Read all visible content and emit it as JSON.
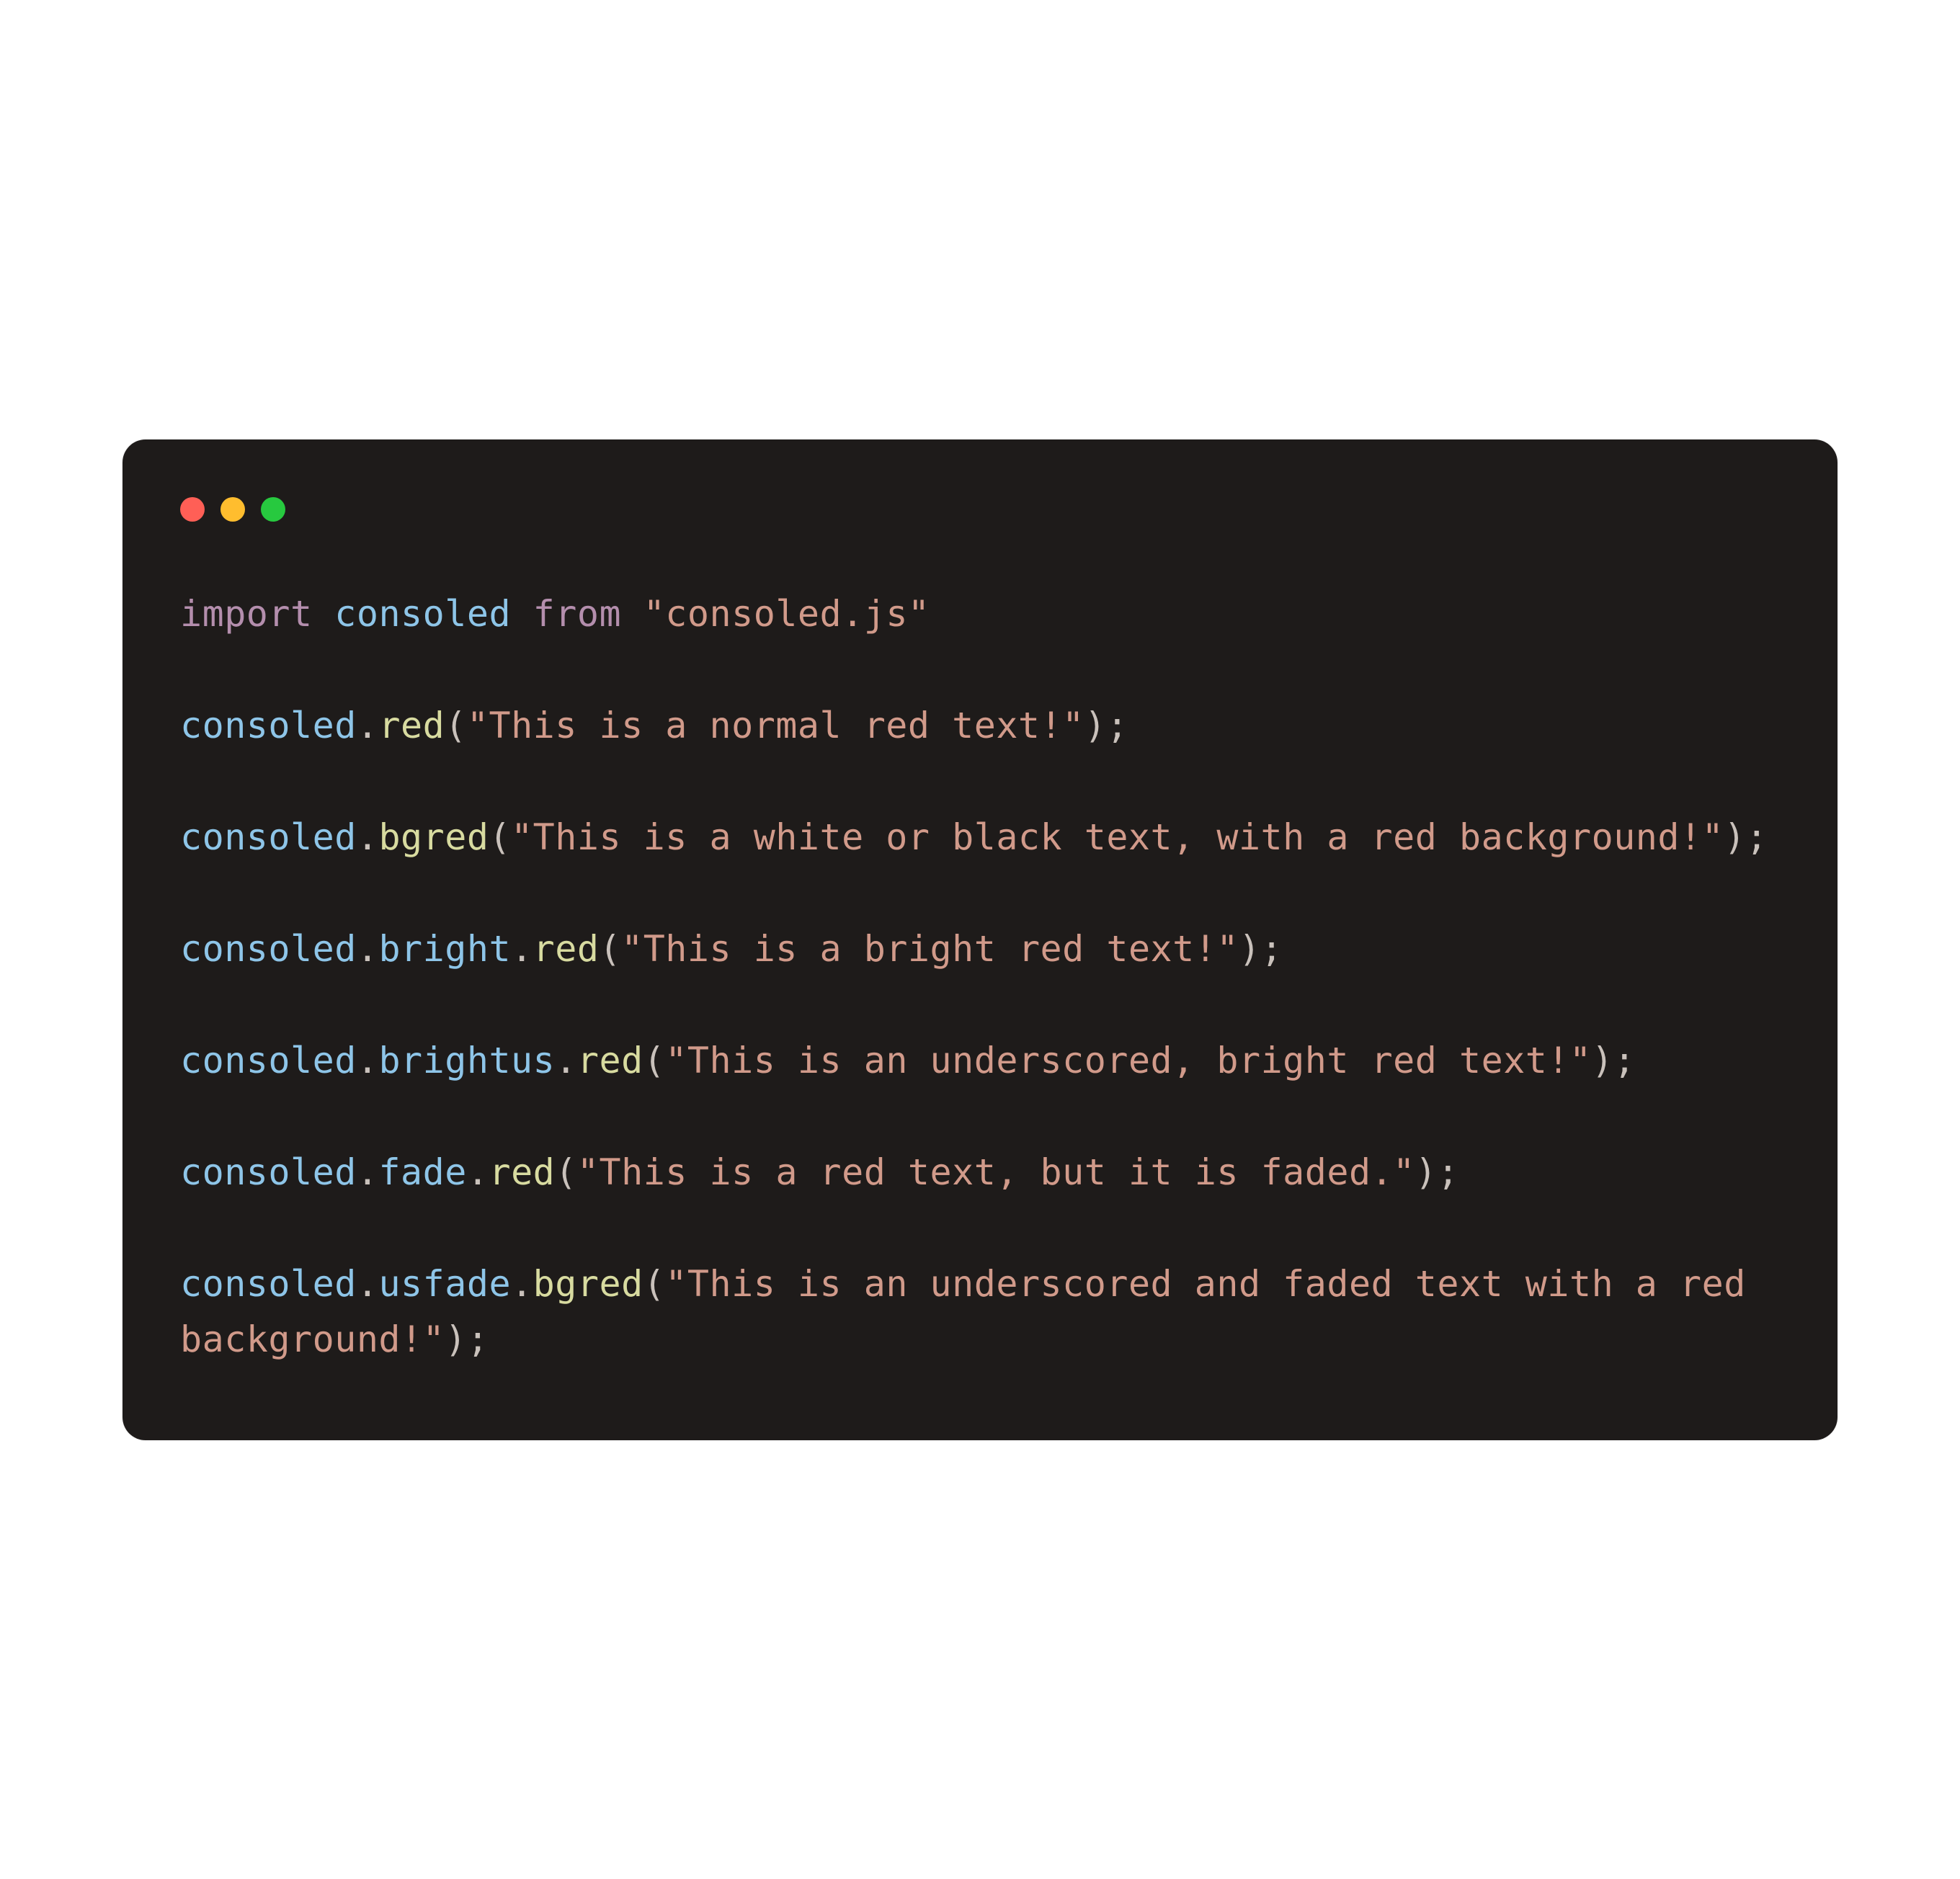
{
  "colors": {
    "bg": "#1e1b1a",
    "traffic_red": "#ff5f56",
    "traffic_yellow": "#ffbd2e",
    "traffic_green": "#27c93f",
    "keyword": "#b48ead",
    "identifier": "#8ec5e8",
    "method": "#d8dba0",
    "string": "#d19a8a",
    "default": "#c9c1bb"
  },
  "code": {
    "lines": [
      [
        {
          "t": "keyword",
          "v": "import"
        },
        {
          "t": "punct",
          "v": " "
        },
        {
          "t": "ident",
          "v": "consoled"
        },
        {
          "t": "punct",
          "v": " "
        },
        {
          "t": "keyword",
          "v": "from"
        },
        {
          "t": "punct",
          "v": " "
        },
        {
          "t": "string",
          "v": "\"consoled.js\""
        }
      ],
      [],
      [
        {
          "t": "ident",
          "v": "consoled"
        },
        {
          "t": "punct",
          "v": "."
        },
        {
          "t": "method",
          "v": "red"
        },
        {
          "t": "punct",
          "v": "("
        },
        {
          "t": "string",
          "v": "\"This is a normal red text!\""
        },
        {
          "t": "punct",
          "v": ");"
        }
      ],
      [],
      [
        {
          "t": "ident",
          "v": "consoled"
        },
        {
          "t": "punct",
          "v": "."
        },
        {
          "t": "method",
          "v": "bgred"
        },
        {
          "t": "punct",
          "v": "("
        },
        {
          "t": "string",
          "v": "\"This is a white or black text, with a red background!\""
        },
        {
          "t": "punct",
          "v": ");"
        }
      ],
      [],
      [
        {
          "t": "ident",
          "v": "consoled"
        },
        {
          "t": "punct",
          "v": "."
        },
        {
          "t": "ident",
          "v": "bright"
        },
        {
          "t": "punct",
          "v": "."
        },
        {
          "t": "method",
          "v": "red"
        },
        {
          "t": "punct",
          "v": "("
        },
        {
          "t": "string",
          "v": "\"This is a bright red text!\""
        },
        {
          "t": "punct",
          "v": ");"
        }
      ],
      [],
      [
        {
          "t": "ident",
          "v": "consoled"
        },
        {
          "t": "punct",
          "v": "."
        },
        {
          "t": "ident",
          "v": "brightus"
        },
        {
          "t": "punct",
          "v": "."
        },
        {
          "t": "method",
          "v": "red"
        },
        {
          "t": "punct",
          "v": "("
        },
        {
          "t": "string",
          "v": "\"This is an underscored, bright red text!\""
        },
        {
          "t": "punct",
          "v": ");"
        }
      ],
      [],
      [
        {
          "t": "ident",
          "v": "consoled"
        },
        {
          "t": "punct",
          "v": "."
        },
        {
          "t": "ident",
          "v": "fade"
        },
        {
          "t": "punct",
          "v": "."
        },
        {
          "t": "method",
          "v": "red"
        },
        {
          "t": "punct",
          "v": "("
        },
        {
          "t": "string",
          "v": "\"This is a red text, but it is faded.\""
        },
        {
          "t": "punct",
          "v": ");"
        }
      ],
      [],
      [
        {
          "t": "ident",
          "v": "consoled"
        },
        {
          "t": "punct",
          "v": "."
        },
        {
          "t": "ident",
          "v": "usfade"
        },
        {
          "t": "punct",
          "v": "."
        },
        {
          "t": "method",
          "v": "bgred"
        },
        {
          "t": "punct",
          "v": "("
        },
        {
          "t": "string",
          "v": "\"This is an underscored and faded text with a red background!\""
        },
        {
          "t": "punct",
          "v": ");"
        }
      ]
    ]
  }
}
